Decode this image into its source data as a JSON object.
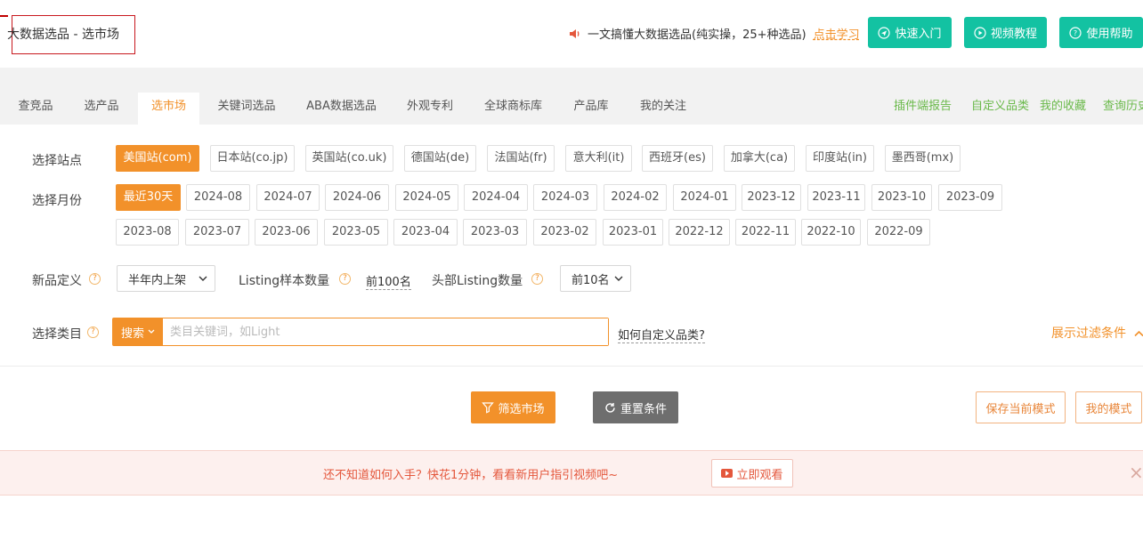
{
  "header": {
    "title": "大数据选品 - 选市场",
    "promo_text": "一文搞懂大数据选品(纯实操，25+种选品)",
    "promo_link": "点击学习",
    "buttons": [
      {
        "label": "快速入门",
        "icon": "send-icon"
      },
      {
        "label": "视频教程",
        "icon": "play-icon"
      },
      {
        "label": "使用帮助",
        "icon": "help-icon"
      }
    ]
  },
  "nav": {
    "tabs": [
      "查竞品",
      "选产品",
      "选市场",
      "关键词选品",
      "ABA数据选品",
      "外观专利",
      "全球商标库",
      "产品库",
      "我的关注"
    ],
    "active_tab": "选市场",
    "right_links": [
      "插件端报告",
      "自定义品类",
      "我的收藏",
      "查询历史"
    ]
  },
  "filters": {
    "site_label": "选择站点",
    "sites": [
      "美国站(com)",
      "日本站(co.jp)",
      "英国站(co.uk)",
      "德国站(de)",
      "法国站(fr)",
      "意大利(it)",
      "西班牙(es)",
      "加拿大(ca)",
      "印度站(in)",
      "墨西哥(mx)"
    ],
    "selected_site": "美国站(com)",
    "month_label": "选择月份",
    "months_row1": [
      "最近30天",
      "2024-08",
      "2024-07",
      "2024-06",
      "2024-05",
      "2024-04",
      "2024-03",
      "2024-02",
      "2024-01",
      "2023-12",
      "2023-11",
      "2023-10",
      "2023-09"
    ],
    "months_row2": [
      "2023-08",
      "2023-07",
      "2023-06",
      "2023-05",
      "2023-04",
      "2023-03",
      "2023-02",
      "2023-01",
      "2022-12",
      "2022-11",
      "2022-10",
      "2022-09"
    ],
    "selected_month": "最近30天",
    "new_def_label": "新品定义",
    "new_def_value": "半年内上架",
    "listing_sample_label": "Listing样本数量",
    "listing_sample_value": "前100名",
    "head_listing_label": "头部Listing数量",
    "head_listing_value": "前10名",
    "category_label": "选择类目",
    "search_button": "搜索",
    "search_placeholder": "类目关键词，如Light",
    "custom_category_link": "如何自定义品类?",
    "toggle_filters": "展示过滤条件"
  },
  "actions": {
    "filter_market": "筛选市场",
    "reset": "重置条件",
    "save_mode": "保存当前模式",
    "my_mode": "我的模式"
  },
  "notice": {
    "text": "还不知道如何入手？快花1分钟，看看新用户指引视频吧~",
    "button": "立即观看",
    "close": "×"
  },
  "colors": {
    "accent": "#f2912a",
    "teal": "#13c2a2",
    "green_link": "#6ab94a",
    "notice_red": "#e4573c"
  }
}
